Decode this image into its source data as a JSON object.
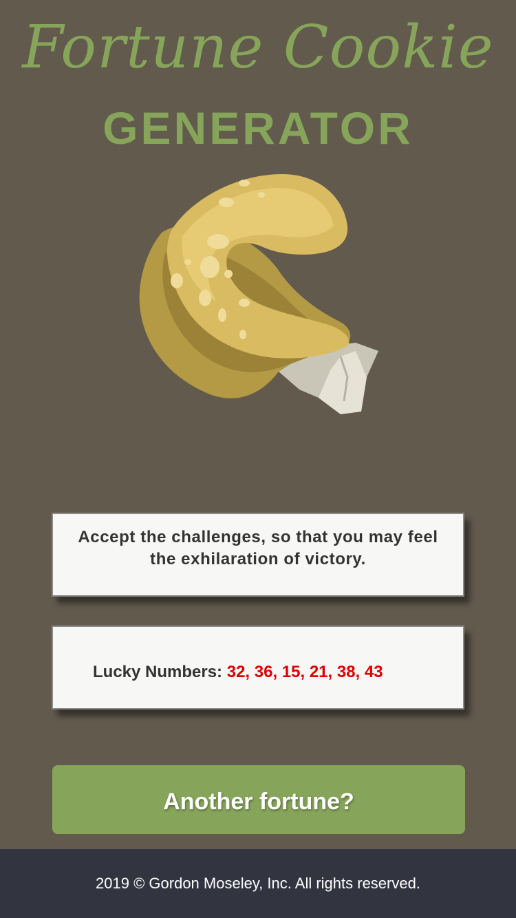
{
  "header": {
    "title": "Fortune Cookie",
    "subtitle": "GENERATOR"
  },
  "cookie_image": {
    "icon": "fortune-cookie-icon"
  },
  "fortune": {
    "text": "Accept the challenges, so that you may feel the exhilaration of victory."
  },
  "lucky": {
    "label": "Lucky Numbers:",
    "numbers": "32, 36, 15, 21, 38, 43"
  },
  "button": {
    "label": "Another fortune?"
  },
  "footer": {
    "text": "2019 © Gordon Moseley, Inc. All rights reserved."
  },
  "colors": {
    "background": "#625a4d",
    "accent": "#87a55a",
    "lucky_numbers": "#e00000",
    "footer": "#323540"
  }
}
